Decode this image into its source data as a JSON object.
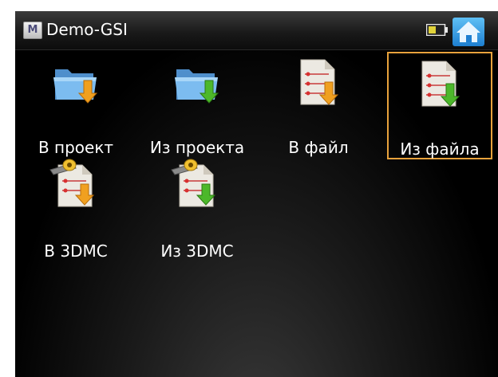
{
  "window": {
    "app_icon": "M",
    "title": "Demo-GSI",
    "battery_icon": "battery-icon",
    "home_icon": "home-icon"
  },
  "tiles": [
    {
      "label": "В проект",
      "icon": "folder-import-icon",
      "selected": false
    },
    {
      "label": "Из проекта",
      "icon": "folder-export-icon",
      "selected": false
    },
    {
      "label": "В файл",
      "icon": "file-import-icon",
      "selected": false
    },
    {
      "label": "Из файла",
      "icon": "file-export-icon",
      "selected": true
    },
    {
      "label": "В 3DMC",
      "icon": "3dmc-import-icon",
      "selected": false
    },
    {
      "label": "Из 3DMC",
      "icon": "3dmc-export-icon",
      "selected": false
    }
  ],
  "colors": {
    "selection": "#e8a23c",
    "arrow_orange": "#f0a020",
    "arrow_green": "#4cb82a",
    "folder_blue": "#6aa8de"
  }
}
